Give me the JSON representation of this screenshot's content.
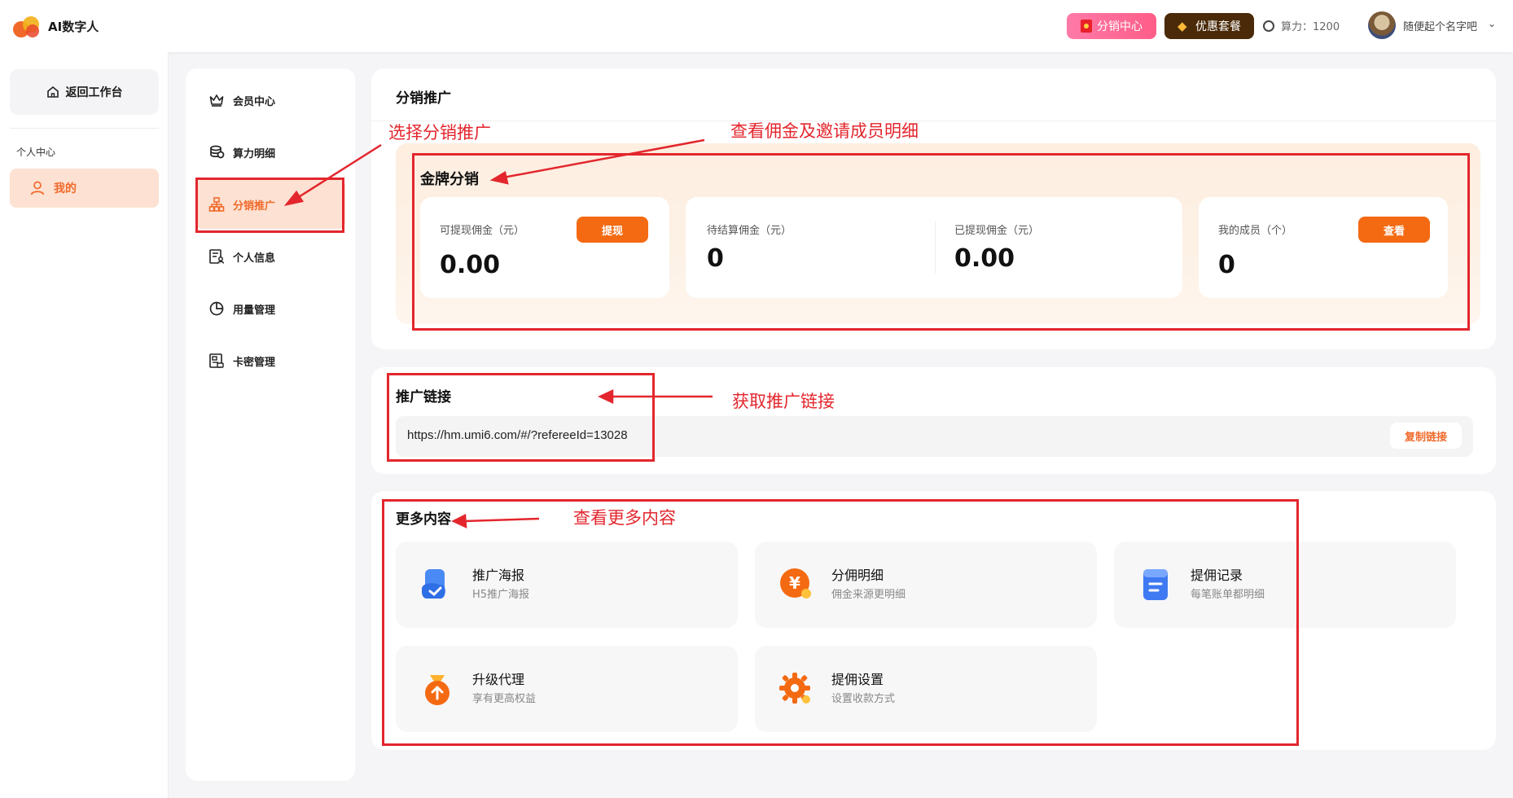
{
  "header": {
    "app_title": "AI数字人",
    "distribution_btn": "分销中心",
    "vip_btn": "优惠套餐",
    "power_label": "算力：1200",
    "username": "随便起个名字吧",
    "chevron": "⌄"
  },
  "sidebar": {
    "back_label": "返回工作台",
    "section_label": "个人中心",
    "mine_label": "我的"
  },
  "menu": {
    "items": [
      {
        "label": "会员中心",
        "icon": "crown-icon"
      },
      {
        "label": "算力明细",
        "icon": "coins-icon"
      },
      {
        "label": "分销推广",
        "icon": "org-chart-icon",
        "active": true
      },
      {
        "label": "个人信息",
        "icon": "profile-doc-icon"
      },
      {
        "label": "用量管理",
        "icon": "pie-chart-icon"
      },
      {
        "label": "卡密管理",
        "icon": "card-key-icon"
      }
    ]
  },
  "promo": {
    "page_title": "分销推广",
    "gold_title": "金牌分销",
    "withdrawable_label": "可提现佣金（元）",
    "withdrawable_value": "0.00",
    "withdraw_btn": "提现",
    "pending_label": "待结算佣金（元）",
    "pending_value": "0",
    "withdrawn_label": "已提现佣金（元）",
    "withdrawn_value": "0.00",
    "members_label": "我的成员（个）",
    "members_value": "0",
    "view_btn": "查看"
  },
  "link": {
    "title": "推广链接",
    "url": "https://hm.umi6.com/#/?refereeId=13028",
    "copy_btn": "复制链接"
  },
  "more": {
    "title": "更多内容",
    "tiles": [
      {
        "title": "推广海报",
        "sub": "H5推广海报",
        "icon": "poster-icon"
      },
      {
        "title": "分佣明细",
        "sub": "佣金来源更明细",
        "icon": "yuan-coin-icon"
      },
      {
        "title": "提佣记录",
        "sub": "每笔账单都明细",
        "icon": "record-doc-icon"
      },
      {
        "title": "升级代理",
        "sub": "享有更高权益",
        "icon": "money-bag-icon"
      },
      {
        "title": "提佣设置",
        "sub": "设置收款方式",
        "icon": "settings-gear-icon"
      }
    ]
  },
  "annotations": {
    "select_promo": "选择分销推广",
    "view_commission": "查看佣金及邀请成员明细",
    "get_link": "获取推广链接",
    "view_more": "查看更多内容"
  },
  "colors": {
    "accent": "#f06a2b",
    "button_orange": "#f46a12",
    "annotation_red": "#e3262d",
    "vip_brown": "#4a2a08",
    "distribution_pink": "#ff5d88"
  }
}
